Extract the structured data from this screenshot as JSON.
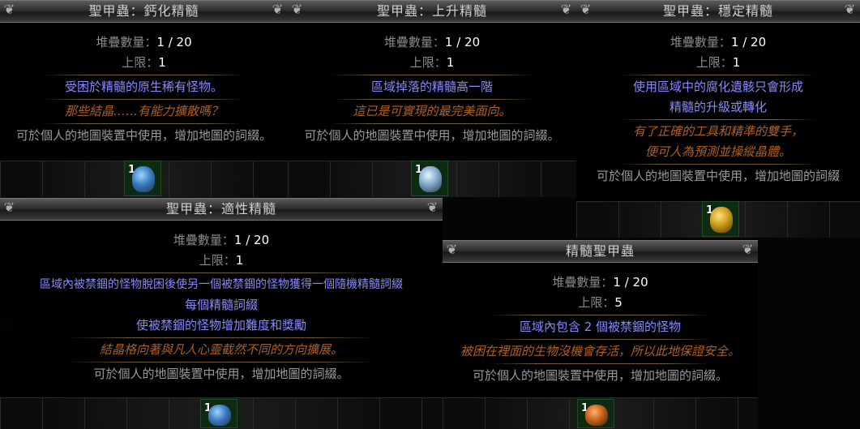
{
  "labels": {
    "stack_label": "堆疊數量：",
    "limit_label": "上限："
  },
  "cards": {
    "calcified": {
      "title": "聖甲蟲：鈣化精髓",
      "stack": "1 / 20",
      "limit": "1",
      "mods": [
        "受困於精髓的原生稀有怪物。"
      ],
      "flavor": [
        "那些結晶……有能力擴散嗎？"
      ],
      "help": "可於個人的地圖裝置中使用，增加地圖的詞綴。",
      "item_count": "1"
    },
    "ascending": {
      "title": "聖甲蟲：上升精髓",
      "stack": "1 / 20",
      "limit": "1",
      "mods": [
        "區域掉落的精髓高一階"
      ],
      "flavor": [
        "這已是可實現的最完美面向。"
      ],
      "help": "可於個人的地圖裝置中使用，增加地圖的詞綴。",
      "item_count": "1"
    },
    "stability": {
      "title": "聖甲蟲：穩定精髓",
      "stack": "1 / 20",
      "limit": "1",
      "mods": [
        "使用區域中的腐化遺骸只會形成",
        "精髓的升級或轉化"
      ],
      "flavor": [
        "有了正確的工具和精準的雙手，",
        "便可人為預測並操縱晶體。"
      ],
      "help": "可於個人的地圖裝置中使用，增加地圖的詞綴",
      "item_count": "1"
    },
    "adaptation": {
      "title": "聖甲蟲：適性精髓",
      "stack": "1 / 20",
      "limit": "1",
      "mods": [
        "區域內被禁錮的怪物脫困後使另一個被禁錮的怪物獲得一個隨機精髓詞綴",
        "每個精髓詞綴",
        "使被禁錮的怪物增加難度和獎勵"
      ],
      "flavor": [
        "結晶格向著與凡人心靈截然不同的方向擴展。"
      ],
      "help": "可於個人的地圖裝置中使用，增加地圖的詞綴。",
      "item_count": "1"
    },
    "essence": {
      "title": "精髓聖甲蟲",
      "stack": "1 / 20",
      "limit": "5",
      "mods": [
        "區域內包含 2 個被禁錮的怪物"
      ],
      "flavor": [
        "被困在裡面的生物沒機會存活，所以此地保證安全。"
      ],
      "help": "可於個人的地圖裝置中使用，增加地圖的詞綴。",
      "item_count": "1"
    }
  },
  "colors": {
    "mod": "#8888ff",
    "flavor": "#af6025",
    "property_value": "#ffffff",
    "property_label": "#8a8a8a",
    "item_cell": "#0d2a12"
  },
  "icons": {
    "header_ornament": "scroll-ornament-icon",
    "item": "scarab-icon"
  }
}
